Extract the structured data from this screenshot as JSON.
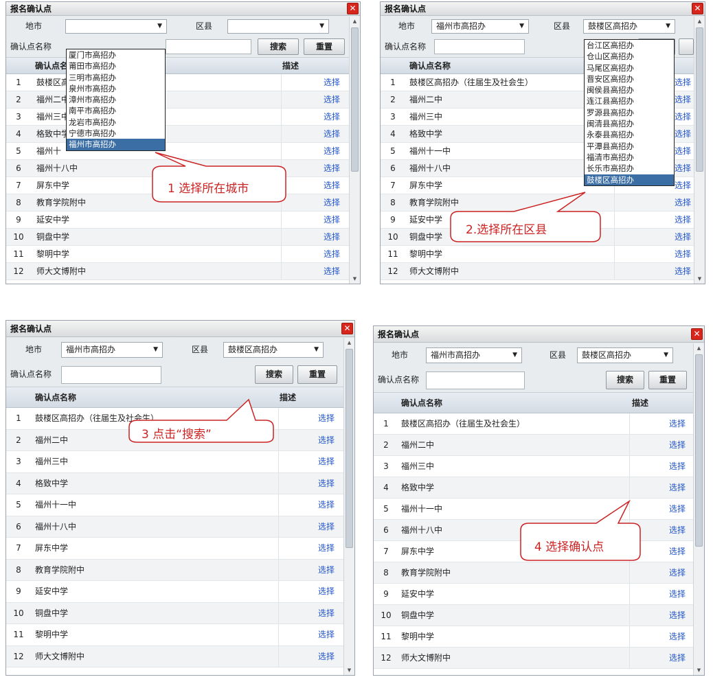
{
  "dialog_title": "报名确认点",
  "close_glyph": "✕",
  "labels": {
    "city": "地市",
    "district": "区县",
    "point_name": "确认点名称",
    "search": "搜索",
    "reset": "重置",
    "col_name": "确认点名称",
    "col_desc": "描述",
    "select": "选择"
  },
  "cities": [
    "厦门市高招办",
    "莆田市高招办",
    "三明市高招办",
    "泉州市高招办",
    "漳州市高招办",
    "南平市高招办",
    "龙岩市高招办",
    "宁德市高招办",
    "福州市高招办"
  ],
  "districts": [
    "台江区高招办",
    "仓山区高招办",
    "马尾区高招办",
    "晋安区高招办",
    "闽侯县高招办",
    "连江县高招办",
    "罗源县高招办",
    "闽清县高招办",
    "永泰县高招办",
    "平潭县高招办",
    "福清市高招办",
    "长乐市高招办",
    "鼓楼区高招办"
  ],
  "selected_city": "福州市高招办",
  "selected_district": "鼓楼区高招办",
  "rows": [
    {
      "n": "1",
      "name": "鼓楼区高招办（往届生及社会生）"
    },
    {
      "n": "2",
      "name": "福州二中"
    },
    {
      "n": "3",
      "name": "福州三中"
    },
    {
      "n": "4",
      "name": "格致中学"
    },
    {
      "n": "5",
      "name": "福州十一中"
    },
    {
      "n": "6",
      "name": "福州十八中"
    },
    {
      "n": "7",
      "name": "屏东中学"
    },
    {
      "n": "8",
      "name": "教育学院附中"
    },
    {
      "n": "9",
      "name": "延安中学"
    },
    {
      "n": "10",
      "name": "铜盘中学"
    },
    {
      "n": "11",
      "name": "黎明中学"
    },
    {
      "n": "12",
      "name": "师大文博附中"
    }
  ],
  "panel1_rows": [
    {
      "n": "1",
      "name": "鼓楼区高"
    },
    {
      "n": "2",
      "name": "福州二中"
    },
    {
      "n": "3",
      "name": "福州三中"
    },
    {
      "n": "4",
      "name": "格致中学"
    },
    {
      "n": "5",
      "name": "福州十"
    },
    {
      "n": "6",
      "name": "福州十八中"
    },
    {
      "n": "7",
      "name": "屏东中学"
    },
    {
      "n": "8",
      "name": "教育学院附中"
    },
    {
      "n": "9",
      "name": "延安中学"
    },
    {
      "n": "10",
      "name": "铜盘中学"
    },
    {
      "n": "11",
      "name": "黎明中学"
    },
    {
      "n": "12",
      "name": "师大文博附中"
    }
  ],
  "annotations": {
    "step1": "1 选择所在城市",
    "step2": "2.选择所在区县",
    "step3": "3 点击“搜索”",
    "step4": "4 选择确认点"
  },
  "colors": {
    "callout": "#cc2222",
    "link": "#2255cc",
    "highlight": "#3a6ea5"
  }
}
